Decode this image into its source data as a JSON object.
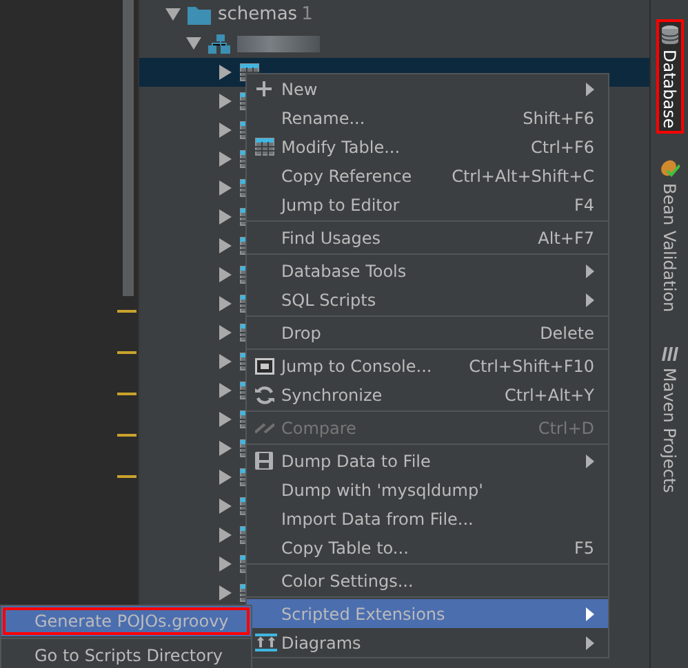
{
  "tree": {
    "folder": {
      "label": "schemas",
      "count": "1",
      "expanded": true
    },
    "schema": {
      "expanded": true
    },
    "tables": [
      {
        "expanded": false,
        "selected": true
      },
      {
        "expanded": false,
        "selected": false
      },
      {
        "expanded": false,
        "selected": false
      },
      {
        "expanded": false,
        "selected": false
      },
      {
        "expanded": false,
        "selected": false
      },
      {
        "expanded": false,
        "selected": false
      },
      {
        "expanded": false,
        "selected": false
      },
      {
        "expanded": false,
        "selected": false
      },
      {
        "expanded": false,
        "selected": false
      },
      {
        "expanded": false,
        "selected": false
      },
      {
        "expanded": false,
        "selected": false
      },
      {
        "expanded": false,
        "selected": false
      },
      {
        "expanded": false,
        "selected": false
      },
      {
        "expanded": false,
        "selected": false
      },
      {
        "expanded": false,
        "selected": false
      },
      {
        "expanded": false,
        "selected": false
      },
      {
        "expanded": false,
        "selected": false
      },
      {
        "expanded": false,
        "selected": false
      },
      {
        "expanded": false,
        "selected": false
      }
    ]
  },
  "context_menu": {
    "sections": [
      [
        {
          "label": "New",
          "submenu": true,
          "selected": false,
          "disabled": false
        },
        {
          "label": "Rename...",
          "shortcut": "Shift+F6",
          "selected": false,
          "disabled": false
        },
        {
          "label": "Modify Table...",
          "shortcut": "Ctrl+F6",
          "selected": false,
          "disabled": false
        },
        {
          "label": "Copy Reference",
          "shortcut": "Ctrl+Alt+Shift+C",
          "selected": false,
          "disabled": false
        },
        {
          "label": "Jump to Editor",
          "shortcut": "F4",
          "selected": false,
          "disabled": false
        }
      ],
      [
        {
          "label": "Find Usages",
          "shortcut": "Alt+F7",
          "selected": false,
          "disabled": false
        }
      ],
      [
        {
          "label": "Database Tools",
          "submenu": true,
          "selected": false,
          "disabled": false
        },
        {
          "label": "SQL Scripts",
          "submenu": true,
          "selected": false,
          "disabled": false
        }
      ],
      [
        {
          "label": "Drop",
          "shortcut": "Delete",
          "selected": false,
          "disabled": false
        }
      ],
      [
        {
          "label": "Jump to Console...",
          "shortcut": "Ctrl+Shift+F10",
          "selected": false,
          "disabled": false
        },
        {
          "label": "Synchronize",
          "shortcut": "Ctrl+Alt+Y",
          "selected": false,
          "disabled": false
        }
      ],
      [
        {
          "label": "Compare",
          "shortcut": "Ctrl+D",
          "selected": false,
          "disabled": true
        }
      ],
      [
        {
          "label": "Dump Data to File",
          "submenu": true,
          "selected": false,
          "disabled": false
        },
        {
          "label": "Dump with 'mysqldump'",
          "selected": false,
          "disabled": false
        },
        {
          "label": "Import Data from File...",
          "selected": false,
          "disabled": false
        },
        {
          "label": "Copy Table to...",
          "shortcut": "F5",
          "selected": false,
          "disabled": false
        }
      ],
      [
        {
          "label": "Color Settings...",
          "selected": false,
          "disabled": false
        }
      ],
      [
        {
          "label": "Scripted Extensions",
          "submenu": true,
          "selected": true,
          "disabled": false
        },
        {
          "label": "Diagrams",
          "submenu": true,
          "selected": false,
          "disabled": false
        }
      ]
    ]
  },
  "submenu": {
    "sections": [
      [
        {
          "label": "Generate POJOs.groovy",
          "selected": true,
          "outlined": true
        }
      ],
      [
        {
          "label": "Go to Scripts Directory",
          "selected": false,
          "outlined": false
        }
      ]
    ]
  },
  "tool_windows": [
    {
      "label": "Database",
      "selected": true,
      "outlined": true
    },
    {
      "label": "Bean Validation",
      "selected": false,
      "outlined": false
    },
    {
      "label": "Maven Projects",
      "selected": false,
      "outlined": false
    }
  ]
}
